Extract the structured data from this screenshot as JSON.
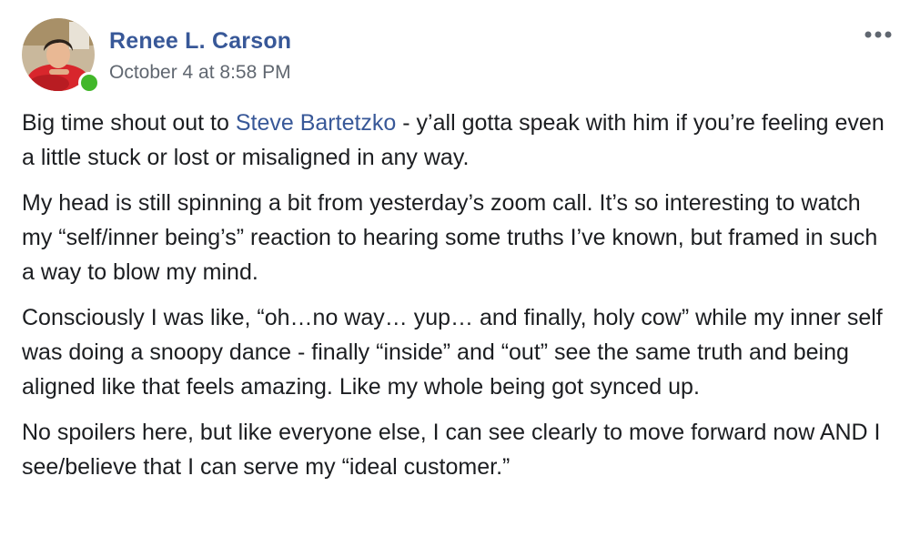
{
  "post": {
    "author": "Renee L. Carson",
    "timestamp": "October 4 at 8:58 PM",
    "online_status_color": "#42b72a",
    "more_icon": "more-horizontal-icon",
    "paragraphs": [
      {
        "before": "Big time shout out to ",
        "mention": "Steve Bartetzko",
        "after": " - y’all gotta speak with him if you’re feeling even a little stuck or lost or misaligned in any way."
      },
      {
        "text": "My head is still spinning a bit from yesterday’s zoom call. It’s so interesting to watch my “self/inner being’s” reaction to hearing some truths I’ve known, but framed in such a way to blow my mind."
      },
      {
        "text": "Consciously I was like, “oh…no way… yup… and finally, holy cow” while my inner self was doing a snoopy dance - finally “inside” and “out” see the same truth and being aligned like that feels amazing. Like my whole being got synced up."
      },
      {
        "text": "No spoilers here, but like everyone else, I can see clearly to move forward now AND I see/believe that I can serve my “ideal customer.”"
      }
    ]
  },
  "colors": {
    "link": "#385898",
    "text": "#1c1e21",
    "secondary": "#606770"
  }
}
